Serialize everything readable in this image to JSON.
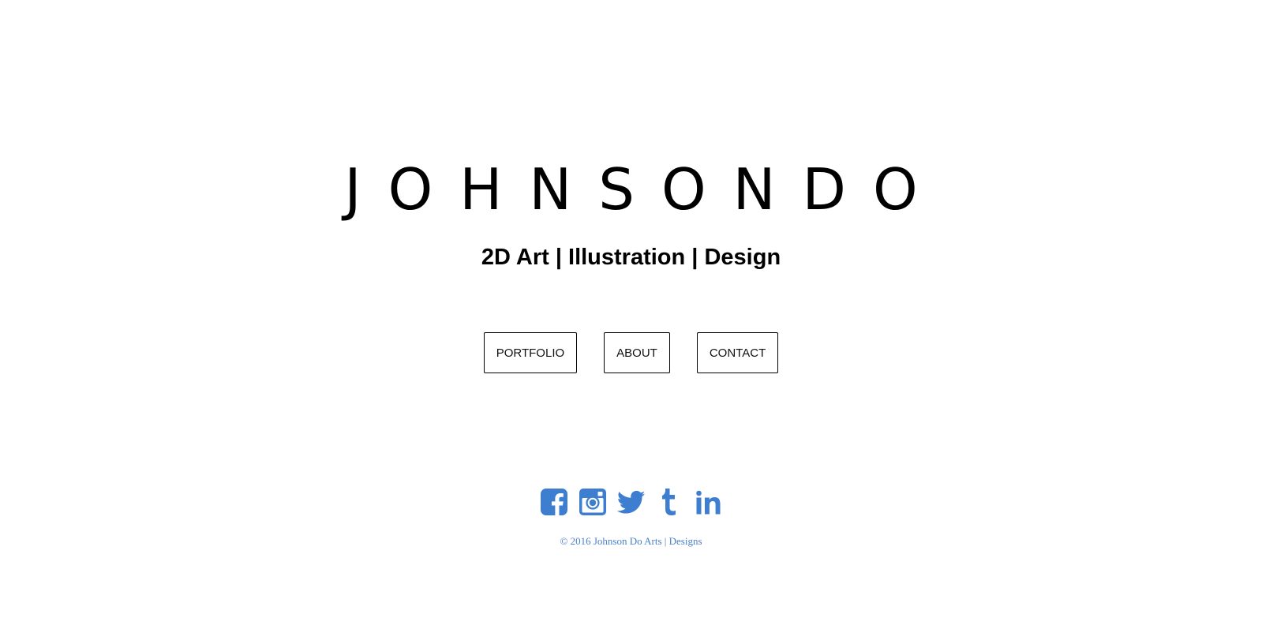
{
  "header": {
    "brand": "JOHNSONDO",
    "tagline": "2D Art | Illustration | Design"
  },
  "nav": {
    "items": [
      {
        "label": "PORTFOLIO"
      },
      {
        "label": "ABOUT"
      },
      {
        "label": "CONTACT"
      }
    ]
  },
  "social": {
    "color": "#3d7ed1",
    "icons": [
      "facebook-icon",
      "instagram-icon",
      "twitter-icon",
      "tumblr-icon",
      "linkedin-icon"
    ]
  },
  "footer": {
    "copyright": "© 2016 Johnson Do Arts | Designs",
    "color": "#4a7fc9"
  }
}
